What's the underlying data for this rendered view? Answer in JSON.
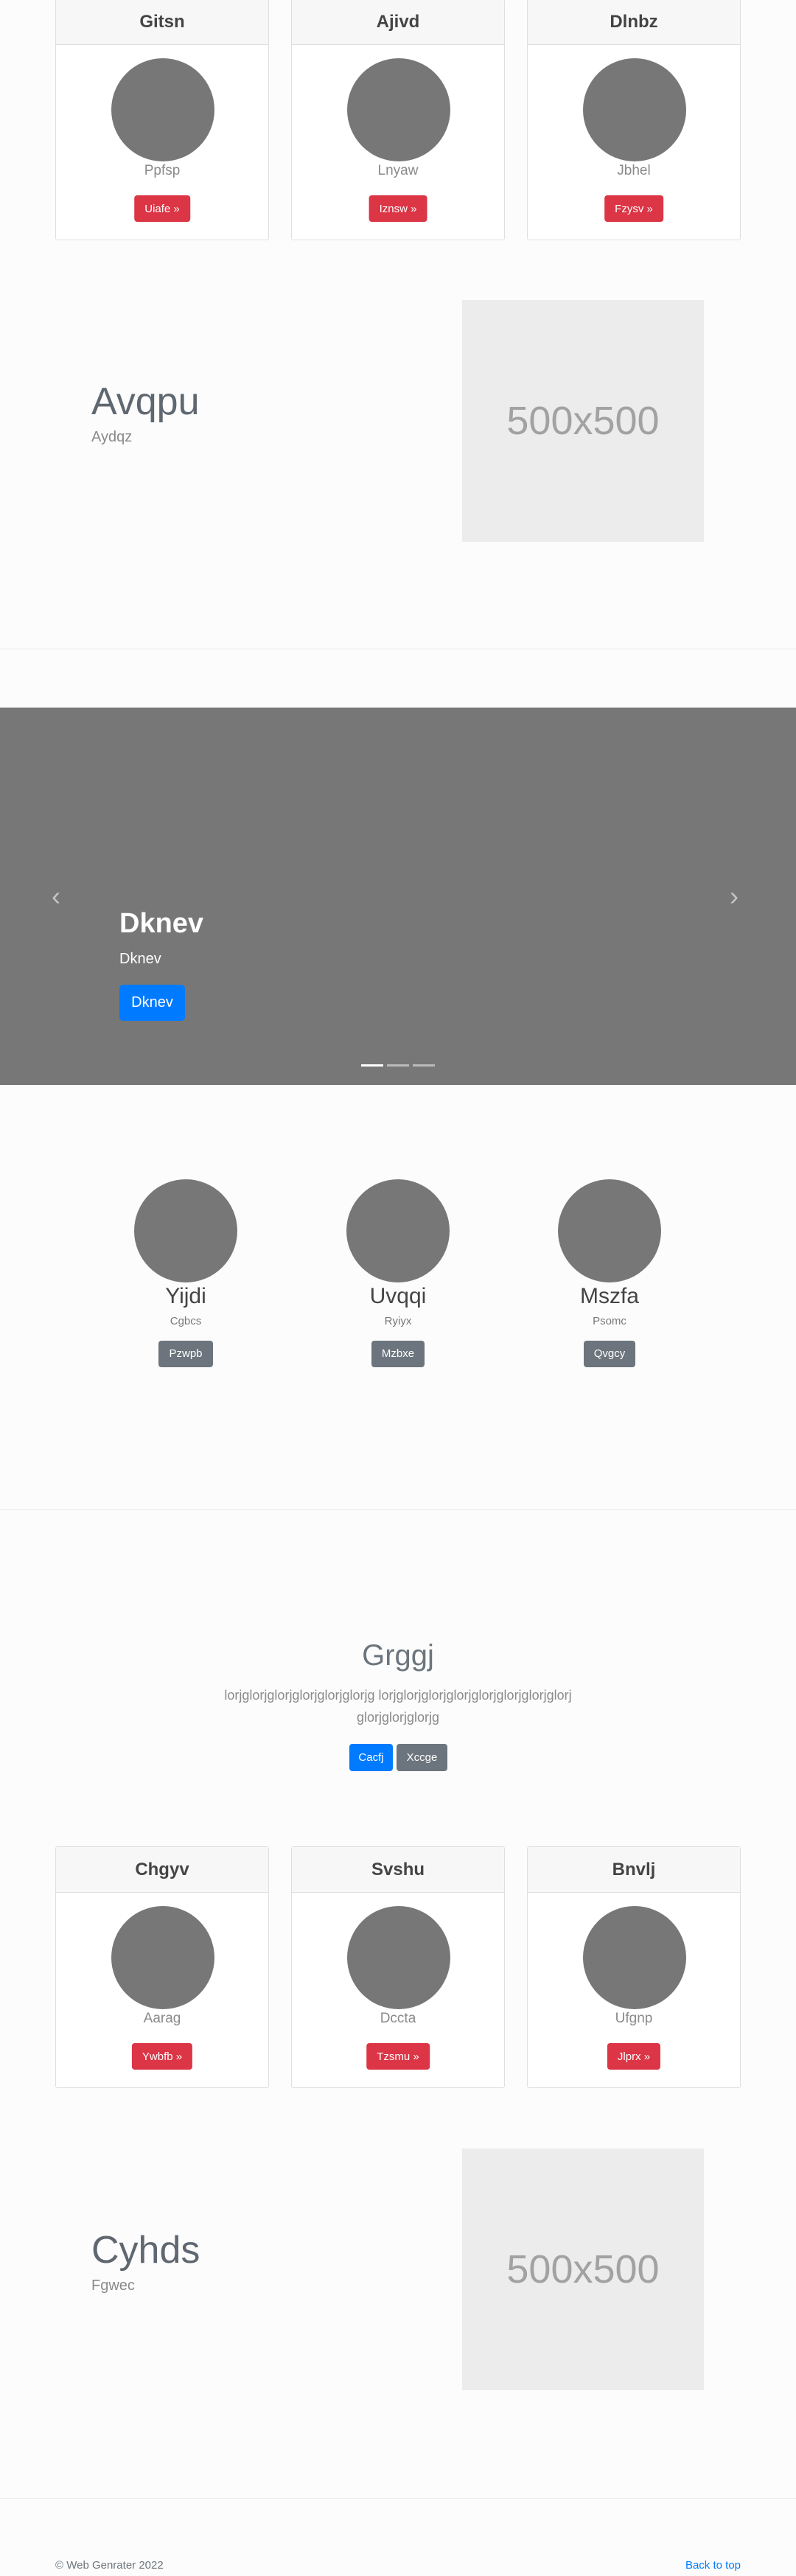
{
  "cards_top": [
    {
      "title": "Gitsn",
      "sub": "Ppfsp",
      "button": "Uiafe »"
    },
    {
      "title": "Ajivd",
      "sub": "Lnyaw",
      "button": "Iznsw »"
    },
    {
      "title": "Dlnbz",
      "sub": "Jbhel",
      "button": "Fzysv »"
    }
  ],
  "feature_top": {
    "title": "Avqpu",
    "subtitle": "Aydqz",
    "placeholder": "500x500"
  },
  "carousel": {
    "title": "Dknev",
    "subtitle": "Dknev",
    "button": "Dknev",
    "prev_icon": "‹",
    "next_icon": "›"
  },
  "team": [
    {
      "name": "Yijdi",
      "sub": "Cgbcs",
      "button": "Pzwpb"
    },
    {
      "name": "Uvqqi",
      "sub": "Ryiyx",
      "button": "Mzbxe"
    },
    {
      "name": "Mszfa",
      "sub": "Psomc",
      "button": "Qvgcy"
    }
  ],
  "hero": {
    "title": "Grggj",
    "text": "lorjglorjglorjglorjglorjglorjg lorjglorjglorjglorjglorjglorjglorjglorjglorjglorjglorjg",
    "primary_button": "Cacfj",
    "secondary_button": "Xccge"
  },
  "cards_bottom": [
    {
      "title": "Chgyv",
      "sub": "Aarag",
      "button": "Ywbfb »"
    },
    {
      "title": "Svshu",
      "sub": "Dccta",
      "button": "Tzsmu »"
    },
    {
      "title": "Bnvlj",
      "sub": "Ufgnp",
      "button": "Jlprx »"
    }
  ],
  "feature_bottom": {
    "title": "Cyhds",
    "subtitle": "Fgwec",
    "placeholder": "500x500"
  },
  "footer": {
    "copyright": "© Web Genrater 2022",
    "back_to_top": "Back to top"
  },
  "colors": {
    "danger": "#dc3545",
    "primary": "#007bff",
    "secondary": "#6c757d",
    "carousel_bg": "#777777",
    "placeholder_bg": "#ececec"
  }
}
